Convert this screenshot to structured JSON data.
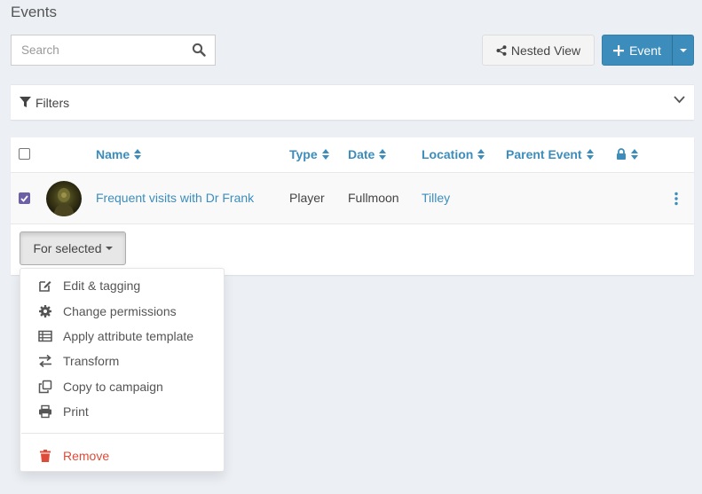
{
  "page": {
    "title": "Events"
  },
  "search": {
    "placeholder": "Search",
    "value": ""
  },
  "toolbar": {
    "nested_view_label": "Nested View",
    "new_event_label": "Event"
  },
  "filters": {
    "label": "Filters"
  },
  "table": {
    "columns": [
      "Name",
      "Type",
      "Date",
      "Location",
      "Parent Event"
    ],
    "rows": [
      {
        "name": "Frequent visits with Dr Frank",
        "type": "Player",
        "date": "Fullmoon",
        "location": "Tilley",
        "parent_event": "",
        "checked": true
      }
    ]
  },
  "bulk": {
    "button_label": "For selected",
    "menu": [
      {
        "label": "Edit & tagging",
        "icon": "edit-icon"
      },
      {
        "label": "Change permissions",
        "icon": "gear-icon"
      },
      {
        "label": "Apply attribute template",
        "icon": "table-list-icon"
      },
      {
        "label": "Transform",
        "icon": "exchange-icon"
      },
      {
        "label": "Copy to campaign",
        "icon": "copy-icon"
      },
      {
        "label": "Print",
        "icon": "print-icon"
      }
    ],
    "danger_item": {
      "label": "Remove",
      "icon": "trash-icon"
    }
  },
  "colors": {
    "accent": "#3c8dbc",
    "danger": "#dd4b39",
    "checkbox": "#6c5fa8",
    "background": "#ecf0f5"
  }
}
